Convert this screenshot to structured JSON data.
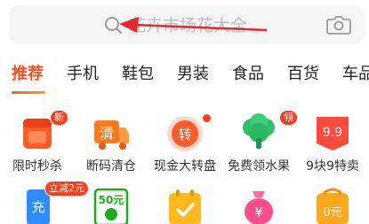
{
  "search": {
    "placeholder": "花卉市场花大全"
  },
  "tabs": [
    {
      "label": "推荐",
      "active": true
    },
    {
      "label": "手机",
      "active": false
    },
    {
      "label": "鞋包",
      "active": false
    },
    {
      "label": "男装",
      "active": false
    },
    {
      "label": "食品",
      "active": false
    },
    {
      "label": "百货",
      "active": false
    },
    {
      "label": "车品",
      "active": false
    }
  ],
  "grid_row1": [
    {
      "label": "限时秒杀",
      "icon": "alarm-clock-icon",
      "badge": "新"
    },
    {
      "label": "断码清仓",
      "icon": "clearance-truck-icon",
      "icon_text": "清"
    },
    {
      "label": "现金大转盘",
      "icon": "spin-wheel-icon",
      "icon_text": "转",
      "dot": true
    },
    {
      "label": "免费领水果",
      "icon": "broccoli-icon",
      "badge": "领"
    },
    {
      "label": "9块9特卖",
      "icon": "price-tag-icon",
      "icon_text": "9.9"
    }
  ],
  "grid_row2": [
    {
      "icon": "phone-recharge-icon",
      "icon_text": "充",
      "badge": "立减2元"
    },
    {
      "icon": "wechat-coupon-icon",
      "icon_text": "50元"
    },
    {
      "icon": "calendar-checkin-icon"
    },
    {
      "icon": "money-bag-icon",
      "icon_text": "¥"
    },
    {
      "icon": "zero-yuan-icon",
      "icon_text": "0元"
    }
  ],
  "colors": {
    "accent": "#ff4a1c",
    "badge": "#ff3b1c"
  }
}
